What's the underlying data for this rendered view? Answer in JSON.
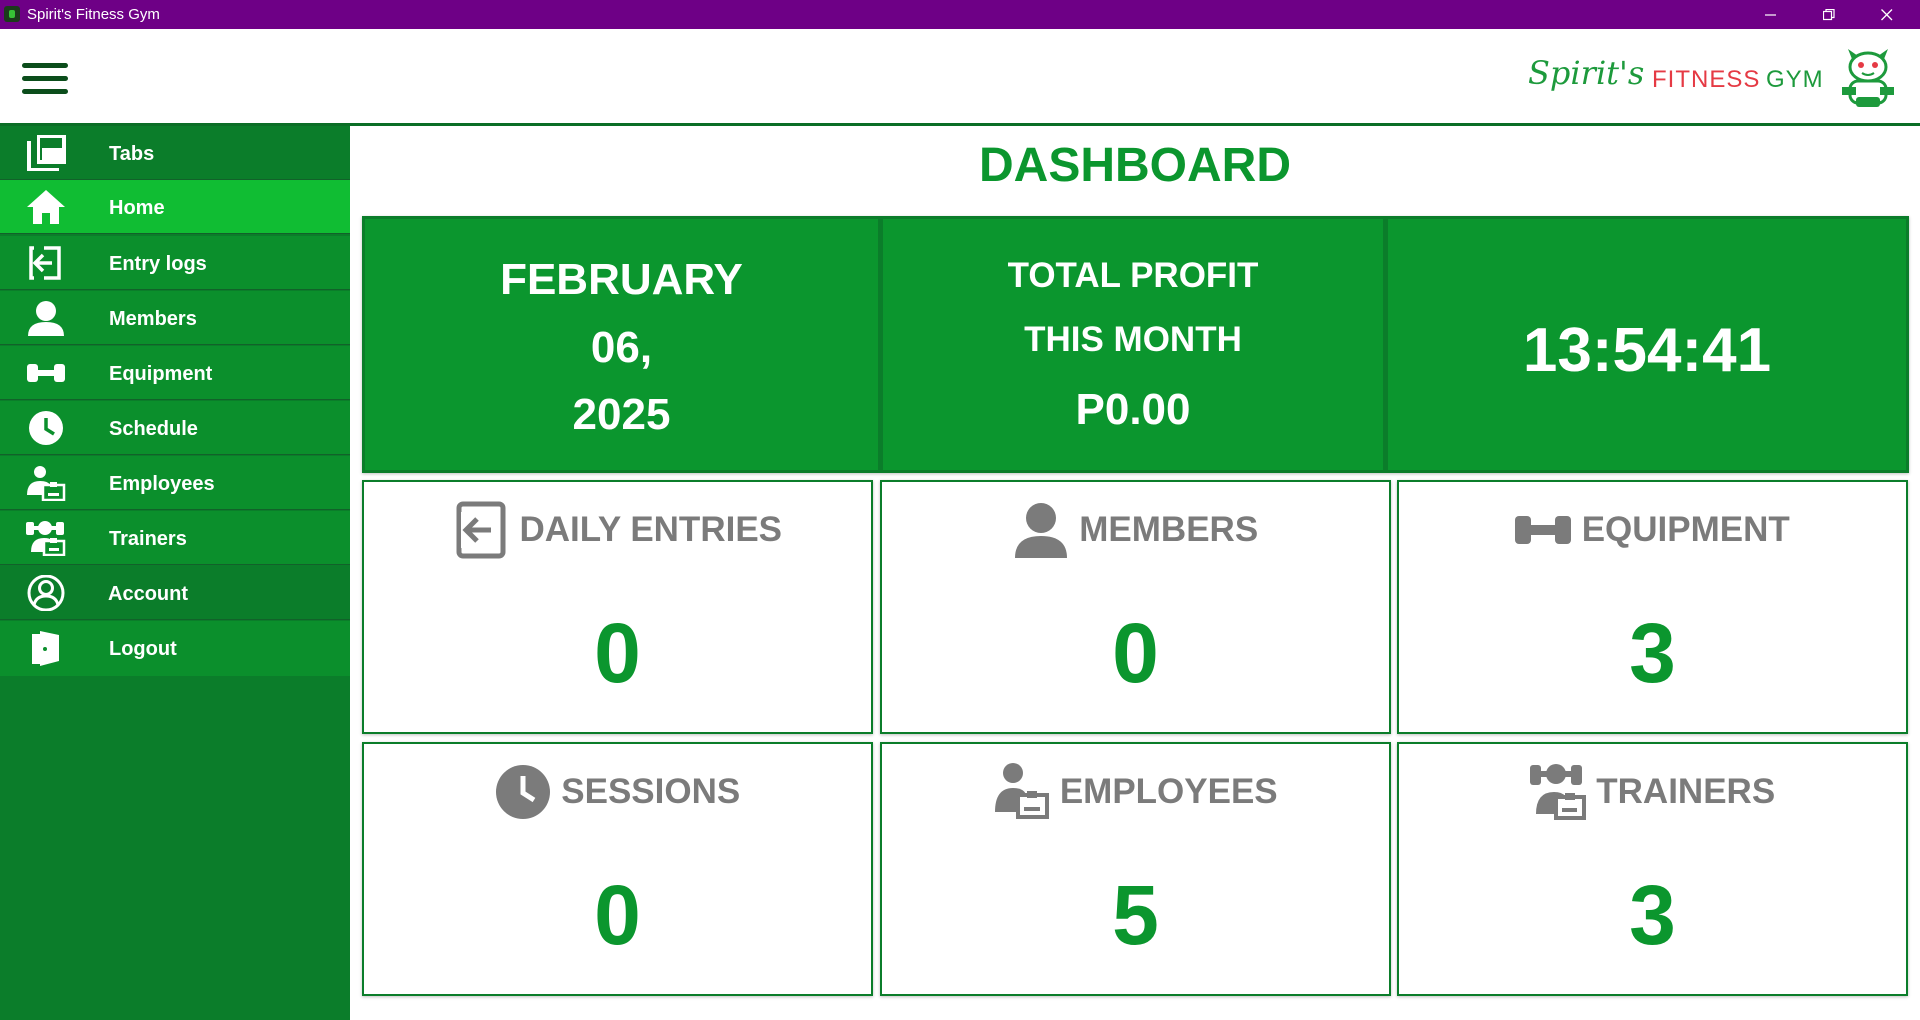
{
  "window": {
    "title": "Spirit's Fitness Gym"
  },
  "logo": {
    "script_text": "Spirit's",
    "fitness_text": "FITNESS",
    "gym_text": "GYM",
    "colors": {
      "green": "#1d9a3c",
      "red": "#e53a44"
    }
  },
  "sidebar": {
    "items": [
      {
        "label": "Tabs",
        "icon": "tabs-icon"
      },
      {
        "label": "Home",
        "icon": "home-icon",
        "active": true
      },
      {
        "label": "Entry logs",
        "icon": "entry-icon"
      },
      {
        "label": "Members",
        "icon": "member-icon"
      },
      {
        "label": "Equipment",
        "icon": "dumbbell-icon"
      },
      {
        "label": "Schedule",
        "icon": "clock-icon"
      },
      {
        "label": "Employees",
        "icon": "employee-icon"
      },
      {
        "label": "Trainers",
        "icon": "trainers-icon"
      },
      {
        "label": "Account",
        "icon": "account-icon"
      },
      {
        "label": "Logout",
        "icon": "logout-icon"
      }
    ]
  },
  "main": {
    "title": "DASHBOARD",
    "date": {
      "line1": "FEBRUARY",
      "line2": "06,",
      "line3": "2025"
    },
    "profit": {
      "line1": "TOTAL PROFIT",
      "line2": "THIS MONTH",
      "value": "P0.00"
    },
    "clock": {
      "time": "13:54:41"
    },
    "stats": [
      {
        "title": "DAILY ENTRIES",
        "value": "0",
        "icon": "entry-icon"
      },
      {
        "title": "MEMBERS",
        "value": "0",
        "icon": "member-icon"
      },
      {
        "title": "EQUIPMENT",
        "value": "3",
        "icon": "dumbbell-icon"
      },
      {
        "title": "SESSIONS",
        "value": "0",
        "icon": "clock-icon"
      },
      {
        "title": "EMPLOYEES",
        "value": "5",
        "icon": "employee-icon"
      },
      {
        "title": "TRAINERS",
        "value": "3",
        "icon": "trainers-icon"
      }
    ]
  },
  "colors": {
    "titlebar": "#6e0086",
    "sidebar": "#0b7d2a",
    "sidebar_active": "#10bd33",
    "accent": "#0b962e",
    "card_title": "#7b7b7b"
  }
}
